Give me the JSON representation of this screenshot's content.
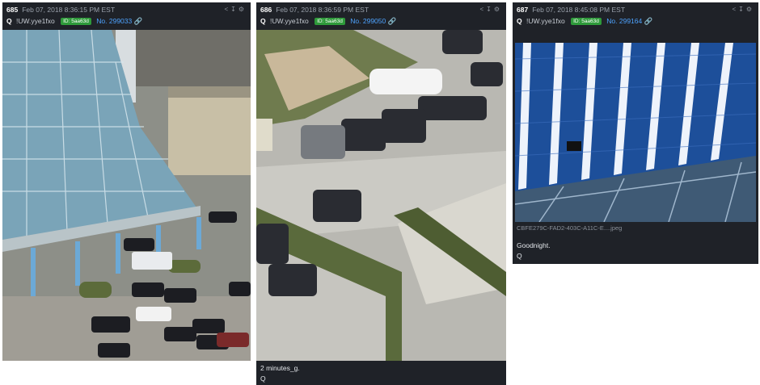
{
  "posts": [
    {
      "number": "685",
      "date": "Feb 07, 2018 8:36:15 PM EST",
      "author": "Q",
      "tripcode": "!UW.yye1fxo",
      "id_badge": "ID: 5aa63d",
      "post_no": "No. 299033",
      "tools": "< ⤓ ⚙"
    },
    {
      "number": "686",
      "date": "Feb 07, 2018 8:36:59 PM EST",
      "author": "Q",
      "tripcode": "!UW.yye1fxo",
      "id_badge": "ID: 5aa63d",
      "post_no": "No. 299050",
      "tools": "< ⤓ ⚙",
      "text_line1": "2 minutes_g.",
      "signature": "Q"
    },
    {
      "number": "687",
      "date": "Feb 07, 2018 8:45:08 PM EST",
      "author": "Q",
      "tripcode": "!UW.yye1fxo",
      "id_badge": "ID: 5aa63d",
      "post_no": "No. 299164",
      "tools": "< ⤓ ⚙",
      "filename": "CBFE279C-FAD2-403C-A11C-E....jpeg",
      "text_line1": "Goodnight.",
      "signature": "Q"
    }
  ],
  "colors": {
    "panel": "#1f2228",
    "link": "#4ea3ff",
    "badge": "#2e9a3a"
  }
}
